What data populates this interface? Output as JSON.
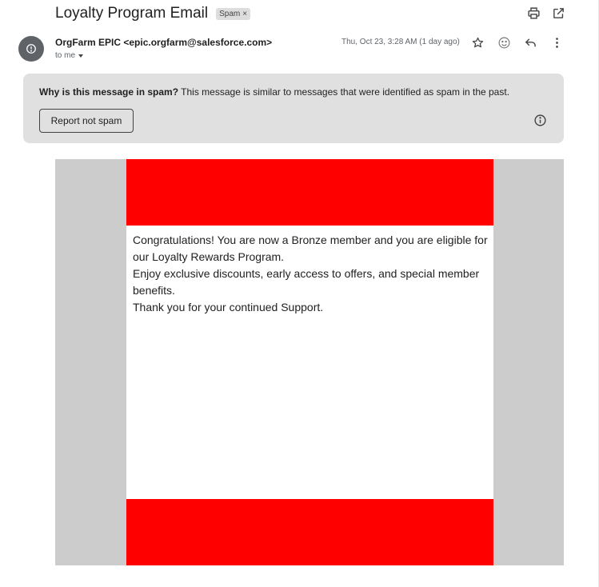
{
  "subject": "Loyalty Program Email",
  "label": {
    "text": "Spam",
    "remove": "×"
  },
  "toolbar_icons": [
    "print-icon",
    "open-in-new-window-icon"
  ],
  "sender": {
    "display": "OrgFarm EPIC <epic.orgfarm@salesforce.com>",
    "recipient": "to me",
    "date": "Thu, Oct 23, 3:28 AM (1 day ago)",
    "avatar_icon": "warning-icon"
  },
  "actions": [
    "star-icon",
    "emoji-icon",
    "reply-icon",
    "more-vert-icon"
  ],
  "spam_banner": {
    "title": "Why is this message in spam?",
    "reason": " This message is similar to messages that were identified as spam in the past.",
    "button": "Report not spam",
    "info_icon": "info-icon"
  },
  "email": {
    "lines": [
      "Congratulations! You are now a Bronze member and you are eligible for our Loyalty Rewards Program.",
      "Enjoy exclusive discounts, early access to offers, and special member benefits.",
      "Thank you for your continued Support."
    ],
    "header_color": "#ff0000",
    "footer_color": "#ff0000",
    "side_color": "#cccccc"
  }
}
